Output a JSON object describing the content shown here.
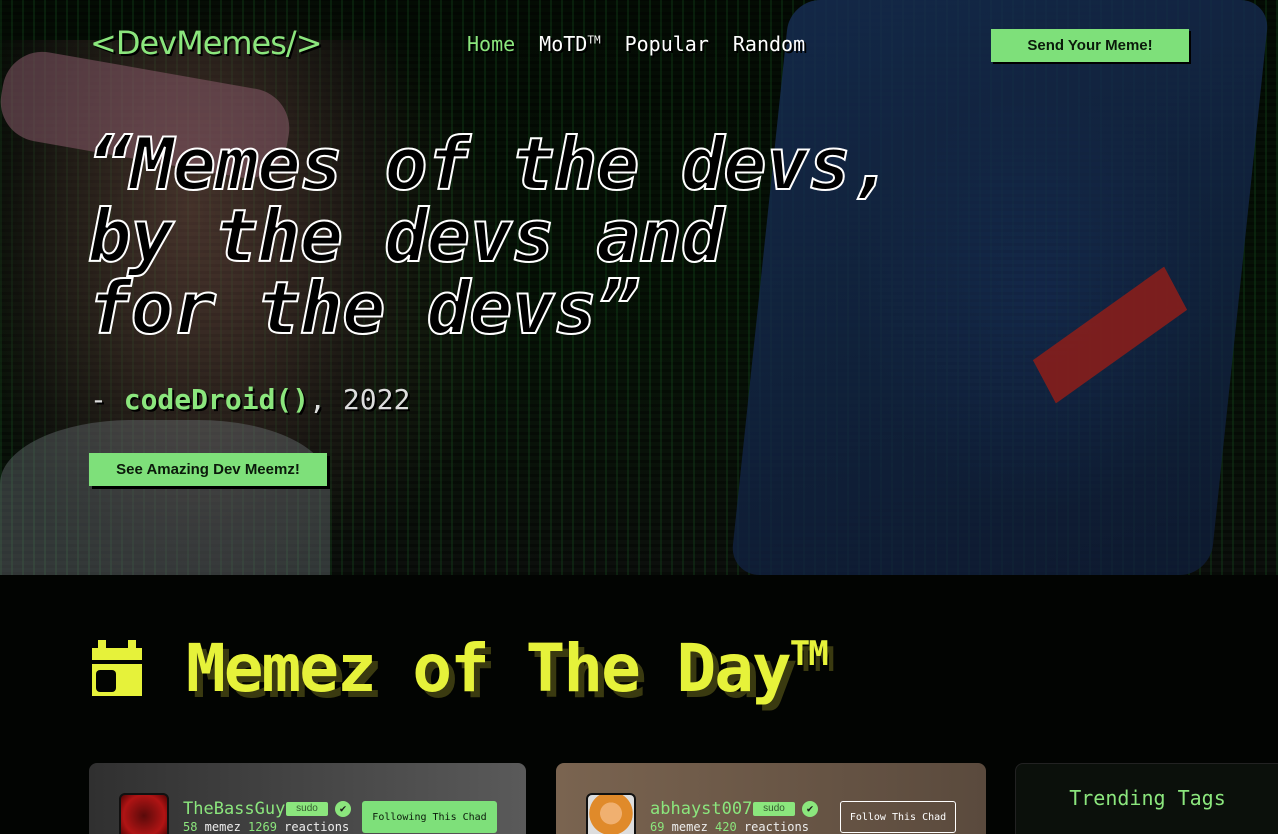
{
  "brand": {
    "logo": "<DevMemes/>"
  },
  "nav": {
    "items": [
      {
        "label": "Home",
        "sup": ""
      },
      {
        "label": "MoTD",
        "sup": "TM"
      },
      {
        "label": "Popular",
        "sup": ""
      },
      {
        "label": "Random",
        "sup": ""
      }
    ],
    "cta": "Send Your Meme!"
  },
  "hero": {
    "quote_lines": [
      "“Memes of the devs,",
      "by the devs and",
      "for the devs”"
    ],
    "attribution": {
      "dash": "- ",
      "name": "codeDroid()",
      "year": ", 2022"
    },
    "button": "See Amazing Dev Meemz!"
  },
  "motd": {
    "title": "Memez of The Day",
    "sup": "TM"
  },
  "cards": [
    {
      "username": "TheBassGuy",
      "badge": "sudo",
      "memez": "58",
      "memez_label": " memez ",
      "reactions": "1269",
      "reactions_label": " reactions",
      "follow": "Following This Chad"
    },
    {
      "username": "abhayst007",
      "badge": "sudo",
      "memez": "69",
      "memez_label": " memez ",
      "reactions": "420",
      "reactions_label": " reactions",
      "follow": "Follow This Chad"
    }
  ],
  "trending": {
    "title": "Trending Tags"
  },
  "colors": {
    "accent": "#8be67d",
    "title_yellow": "#e6f23a",
    "background": "#020402"
  }
}
